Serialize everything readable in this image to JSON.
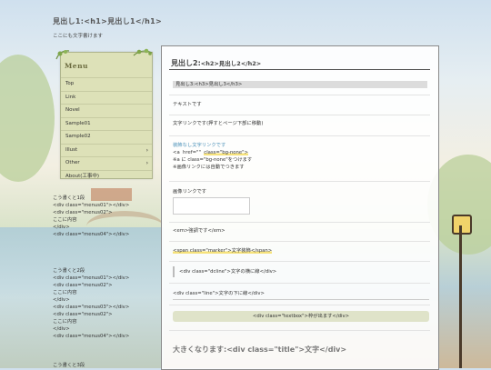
{
  "header": {
    "title": "見出し1:<h1>見出し1</h1>",
    "description": "ここにも文字書けます"
  },
  "menu": {
    "title": "Menu",
    "items": [
      {
        "label": "Top",
        "has_arrow": false
      },
      {
        "label": "Link",
        "has_arrow": false
      },
      {
        "label": "Novel",
        "has_arrow": false
      },
      {
        "label": "Sample01",
        "has_arrow": false
      },
      {
        "label": "Sample02",
        "has_arrow": false
      },
      {
        "label": "Illust",
        "has_arrow": true
      },
      {
        "label": "Other",
        "has_arrow": true
      },
      {
        "label": "About(工事中)",
        "has_arrow": false
      }
    ],
    "arrow_glyph": "›"
  },
  "sidebar": {
    "block1": "こう書くと1段\n<div class=\"menus01\"></div>\n<div class=\"menus02\">\nここに内容\n</div>\n<div class=\"menus04\"></div>",
    "block2": "こう書くと2段\n<div class=\"menus01\"></div>\n<div class=\"menus02\">\nここに内容\n</div>\n<div class=\"menus03\"></div>\n<div class=\"menus02\">\nここに内容\n</div>\n<div class=\"menus04\"></div>",
    "block3": "こう書くと3段"
  },
  "main": {
    "h2_prefix": "見出し2:",
    "h2_code": "<h2>見出し2</h2>",
    "h3": "見出し3:<h3>見出し3</h3>",
    "text": "テキストです",
    "link_text": "文字リンクです",
    "link_suffix": "(押すとページ下部に移動)",
    "bgnone_title": "装飾なし文字リンクです",
    "bgnone_code_prefix": "<a  href=\"\"  ",
    "bgnone_code_marker": "class=\"bg-none\">",
    "bgnone_note1": "※a に class=\"bg-none\"をつけます",
    "bgnone_note2": "※画像リンクには自動でつきます",
    "image_link_label": "画像リンクです",
    "em_text": "<em>強調です</em>",
    "marker_text": "<span class=\"marker\">文字装飾</span>",
    "dcline_text": "<div class=\"dcline\">文字の横に線</div>",
    "line_text": "<div class=\"line\">文字の下に線</div>",
    "textbox_text": "<div class=\"textbox\">枠が出ます</div>",
    "title_text": "大きくなります:<div class=\"title\">文字</div>"
  },
  "colors": {
    "link": "#4a90b8",
    "marker": "#f6e27a",
    "menu_bg": "#dde1b8",
    "textbox_bg": "#dfe3c9"
  }
}
